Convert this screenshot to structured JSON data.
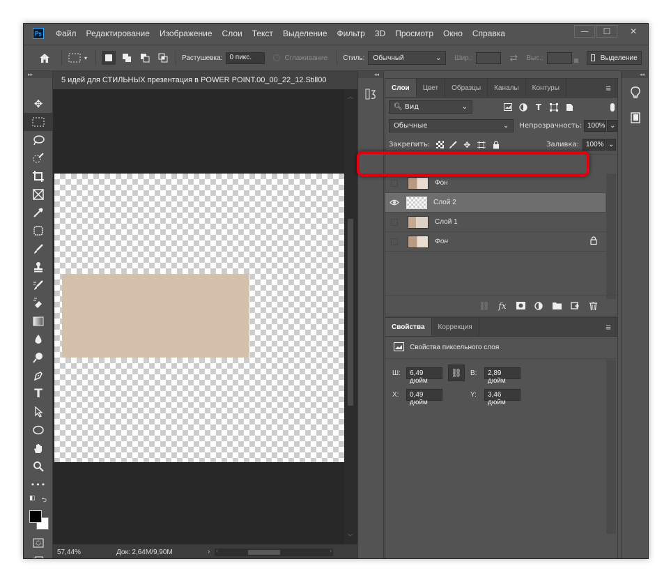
{
  "app": {
    "logo": "Ps"
  },
  "menu": [
    "Файл",
    "Редактирование",
    "Изображение",
    "Слои",
    "Текст",
    "Выделение",
    "Фильтр",
    "3D",
    "Просмотр",
    "Окно",
    "Справка"
  ],
  "window_controls": {
    "minimize": "—",
    "maximize": "☐",
    "close": "✕"
  },
  "options": {
    "feather_label": "Растушевка:",
    "feather_value": "0 пикс.",
    "antialias_label": "Сглаживание",
    "style_label": "Стиль:",
    "style_value": "Обычный",
    "width_label": "Шир.:",
    "height_label": "Выс.:",
    "selection_button": "Выделение"
  },
  "document": {
    "tab_title": "5 идей для СТИЛЬНЫХ презентация в POWER POINT.00_00_22_12.Still00",
    "zoom": "57,44%",
    "doc_info": "Док: 2,64M/9,90M"
  },
  "layers_panel": {
    "tabs": [
      "Слои",
      "Цвет",
      "Образцы",
      "Каналы",
      "Контуры"
    ],
    "filter_label": "Вид",
    "blend_mode": "Обычные",
    "opacity_label": "Непрозрачность:",
    "opacity_value": "100%",
    "lock_label": "Закрепить:",
    "fill_label": "Заливка:",
    "fill_value": "100%",
    "layers": [
      {
        "name": "Фон",
        "visible": false,
        "selected": false,
        "italic": false,
        "locked": false
      },
      {
        "name": "Слой 2",
        "visible": true,
        "selected": true,
        "italic": false,
        "locked": false
      },
      {
        "name": "Слой 1",
        "visible": false,
        "selected": false,
        "italic": false,
        "locked": false
      },
      {
        "name": "Фон",
        "visible": false,
        "selected": false,
        "italic": true,
        "locked": true
      }
    ]
  },
  "properties_panel": {
    "tabs": [
      "Свойства",
      "Коррекция"
    ],
    "subtitle": "Свойства пиксельного слоя",
    "w_label": "Ш:",
    "w_value": "6,49 дюйм",
    "h_label": "В:",
    "h_value": "2,89 дюйм",
    "x_label": "X:",
    "x_value": "0,49 дюйм",
    "y_label": "Y:",
    "y_value": "3,46 дюйм"
  },
  "colors": {
    "canvas_shape": "#d4c0ab",
    "highlight": "#e3000f",
    "foreground": "#000000",
    "background": "#ffffff"
  }
}
